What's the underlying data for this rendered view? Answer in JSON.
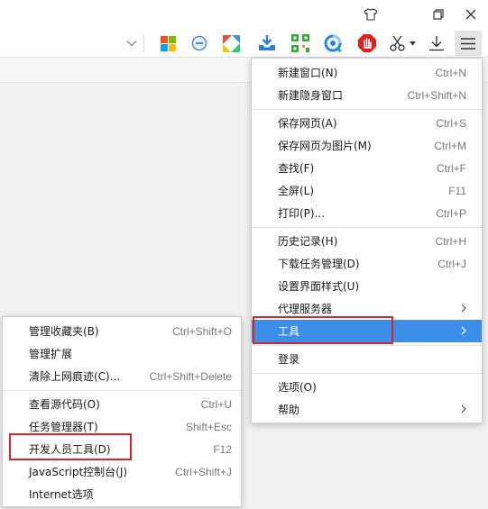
{
  "colors": {
    "highlight": "#3d8ee8",
    "annotation": "#d9242e",
    "menu_bg": "#ffffff"
  },
  "window": {
    "buttons": [
      {
        "name": "skin-icon"
      },
      {
        "name": "restore-icon"
      },
      {
        "name": "close-icon"
      }
    ]
  },
  "toolbar": {
    "icons": [
      "windows-logo-icon",
      "minus-circle-icon",
      "colorful-app-icon",
      "download-tray-icon",
      "qr-code-icon",
      "blue-sync-icon",
      "red-stop-hand-icon",
      "scissors-icon",
      "download-arrow-icon",
      "hamburger-menu-icon"
    ]
  },
  "main_menu": {
    "groups": [
      [
        {
          "label": "新建窗口(N)",
          "shortcut": "Ctrl+N"
        },
        {
          "label": "新建隐身窗口",
          "shortcut": "Ctrl+Shift+N"
        }
      ],
      [
        {
          "label": "保存网页(A)",
          "shortcut": "Ctrl+S"
        },
        {
          "label": "保存网页为图片(M)",
          "shortcut": "Ctrl+M"
        },
        {
          "label": "查找(F)",
          "shortcut": "Ctrl+F"
        },
        {
          "label": "全屏(L)",
          "shortcut": "F11"
        },
        {
          "label": "打印(P)...",
          "shortcut": "Ctrl+P"
        }
      ],
      [
        {
          "label": "历史记录(H)",
          "shortcut": "Ctrl+H"
        },
        {
          "label": "下载任务管理(D)",
          "shortcut": "Ctrl+J"
        },
        {
          "label": "设置界面样式(U)",
          "shortcut": ""
        },
        {
          "label": "代理服务器",
          "shortcut": "",
          "submenu": true
        },
        {
          "label": "工具",
          "shortcut": "",
          "submenu": true,
          "highlighted": true
        }
      ],
      [
        {
          "label": "登录",
          "shortcut": ""
        }
      ],
      [
        {
          "label": "选项(O)",
          "shortcut": ""
        },
        {
          "label": "帮助",
          "shortcut": "",
          "submenu": true
        }
      ]
    ]
  },
  "tools_submenu": {
    "groups": [
      [
        {
          "label": "管理收藏夹(B)",
          "shortcut": "Ctrl+Shift+O"
        },
        {
          "label": "管理扩展",
          "shortcut": ""
        },
        {
          "label": "清除上网痕迹(C)...",
          "shortcut": "Ctrl+Shift+Delete"
        }
      ],
      [
        {
          "label": "查看源代码(O)",
          "shortcut": "Ctrl+U"
        },
        {
          "label": "任务管理器(T)",
          "shortcut": "Shift+Esc"
        },
        {
          "label": "开发人员工具(D)",
          "shortcut": "F12"
        },
        {
          "label": "JavaScript控制台(J)",
          "shortcut": "Ctrl+Shift+J"
        },
        {
          "label": "Internet选项",
          "shortcut": ""
        }
      ]
    ]
  }
}
